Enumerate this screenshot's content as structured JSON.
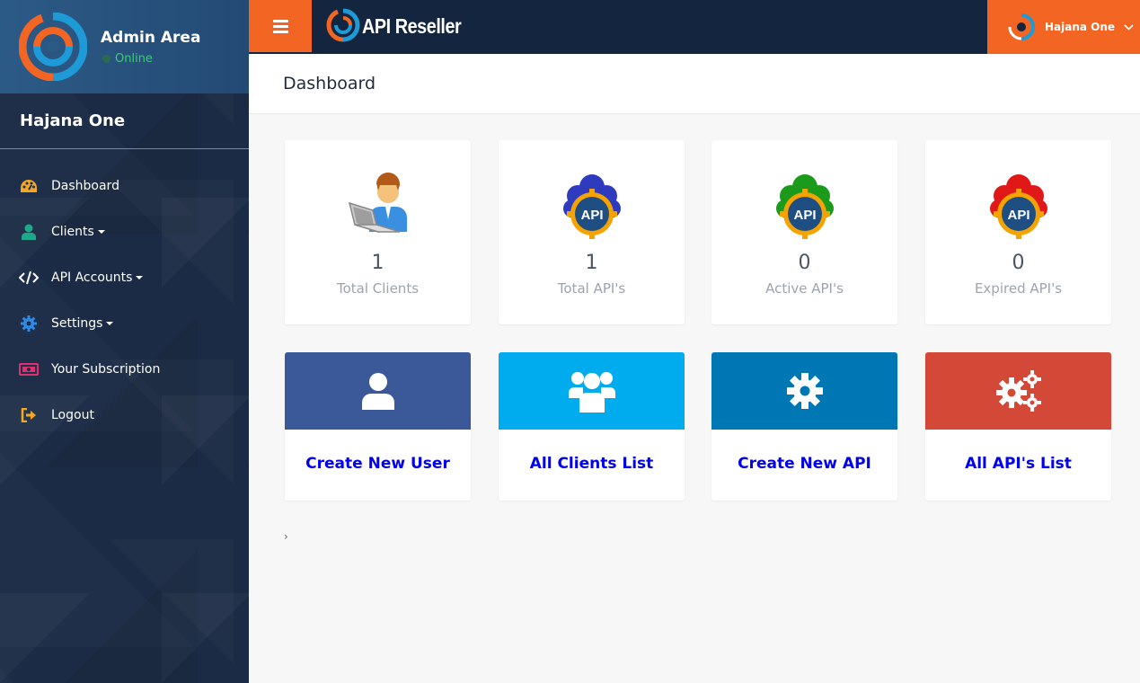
{
  "sidebar": {
    "title": "Admin Area",
    "status": "Online",
    "user_name": "Hajana One",
    "items": [
      {
        "label": "Dashboard",
        "icon": "dashboard-icon",
        "has_caret": false
      },
      {
        "label": "Clients",
        "icon": "user-icon",
        "has_caret": true
      },
      {
        "label": "API Accounts",
        "icon": "code-icon",
        "has_caret": true
      },
      {
        "label": "Settings",
        "icon": "gear-icon",
        "has_caret": true
      },
      {
        "label": "Your Subscription",
        "icon": "money-icon",
        "has_caret": false
      },
      {
        "label": "Logout",
        "icon": "logout-icon",
        "has_caret": false
      }
    ]
  },
  "topbar": {
    "brand": "API Reseller",
    "user_name": "Hajana One"
  },
  "page": {
    "title": "Dashboard",
    "breadcrumb_arrow": "›"
  },
  "stats": [
    {
      "value": "1",
      "label": "Total Clients",
      "icon": "client-laptop-icon"
    },
    {
      "value": "1",
      "label": "Total API's",
      "icon": "api-cloud-blue-icon",
      "color": "#2f3bbf"
    },
    {
      "value": "0",
      "label": "Active API's",
      "icon": "api-cloud-green-icon",
      "color": "#1c9a1c"
    },
    {
      "value": "0",
      "label": "Expired API's",
      "icon": "api-cloud-red-icon",
      "color": "#e01818"
    }
  ],
  "actions": [
    {
      "label": "Create New User",
      "icon": "user-icon",
      "color": "#3b5998"
    },
    {
      "label": "All Clients List",
      "icon": "users-icon",
      "color": "#00acee"
    },
    {
      "label": "Create New API",
      "icon": "gear-icon",
      "color": "#0077b5"
    },
    {
      "label": "All API's List",
      "icon": "gears-icon",
      "color": "#d34836"
    }
  ],
  "colors": {
    "accent": "#f26522",
    "sidebar_bg": "#1c2b45",
    "topbar_bg": "#14263f",
    "link": "#0000ee"
  }
}
